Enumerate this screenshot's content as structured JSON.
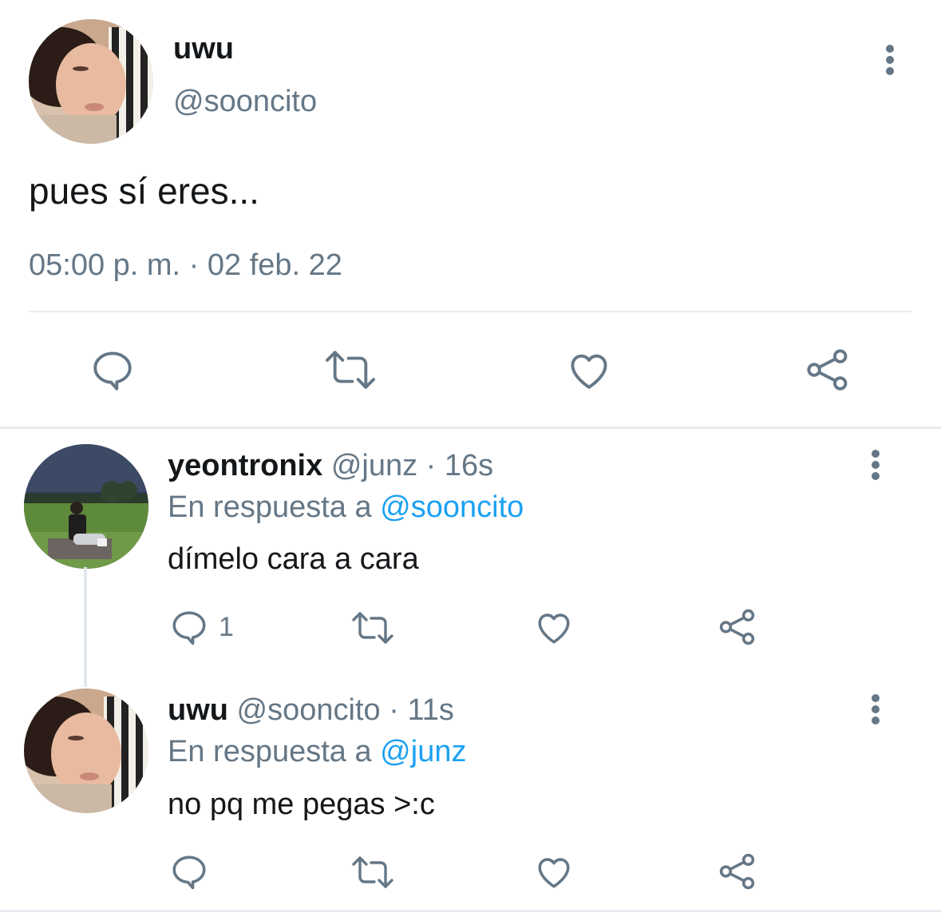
{
  "main_tweet": {
    "name": "uwu",
    "handle": "@sooncito",
    "text": "pues sí eres...",
    "timestamp": "05:00 p. m. · 02 feb. 22",
    "actions": [
      "reply-icon",
      "retweet-icon",
      "like-icon",
      "share-icon"
    ]
  },
  "replies": [
    {
      "name": "yeontronix",
      "handle": "@junz",
      "time": "16s",
      "separator": " · ",
      "reply_prefix": "En respuesta a ",
      "reply_to": "@sooncito",
      "text": "dímelo cara a cara",
      "reply_count": "1"
    },
    {
      "name": "uwu",
      "handle": "@sooncito",
      "time": "11s",
      "separator": " · ",
      "reply_prefix": "En respuesta a ",
      "reply_to": "@junz",
      "text": "no pq me pegas >:c",
      "reply_count": ""
    }
  ],
  "colors": {
    "text_primary": "#14171a",
    "text_secondary": "#657786",
    "link": "#1da1f2",
    "divider": "#e6ecf0"
  }
}
